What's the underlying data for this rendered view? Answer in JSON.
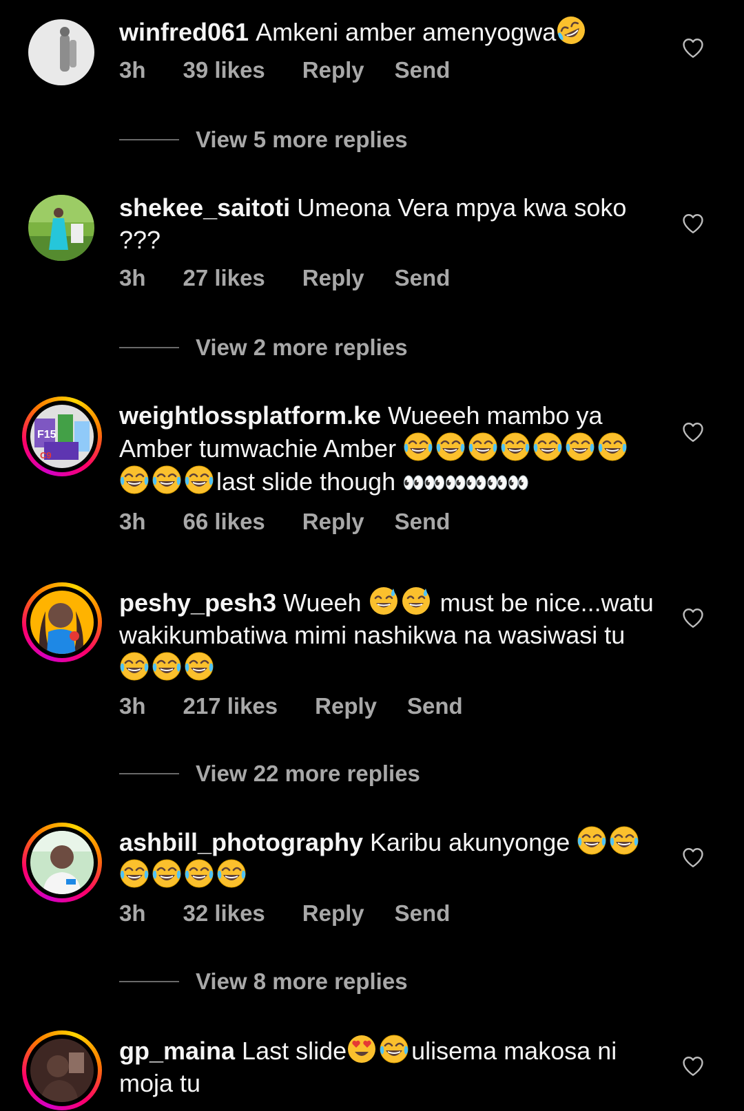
{
  "colors": {
    "background": "#000000",
    "primary_text": "#f5f5f5",
    "secondary_text": "#a8a8a8",
    "divider": "#6a6a6a"
  },
  "comments": [
    {
      "username": "winfred061",
      "text": "Amkeni amber amenyogwa",
      "time": "3h",
      "likes": "39 likes",
      "reply": "Reply",
      "send": "Send",
      "view_replies": "View 5 more replies"
    },
    {
      "username": "shekee_saitoti",
      "text": "Umeona Vera mpya kwa soko ???",
      "time": "3h",
      "likes": "27 likes",
      "reply": "Reply",
      "send": "Send",
      "view_replies": "View 2 more replies"
    },
    {
      "username": "weightlossplatform.ke",
      "text_a": "Wueeeh mambo ya Amber tumwachie Amber",
      "text_b": "last slide though",
      "eyes": "👀👀👀👀👀👀",
      "time": "3h",
      "likes": "66 likes",
      "reply": "Reply",
      "send": "Send"
    },
    {
      "username": "peshy_pesh3",
      "text_a": "Wueeh",
      "text_b": "must be nice...watu wakikumbatiwa mimi nashikwa na wasiwasi tu",
      "time": "3h",
      "likes": "217 likes",
      "reply": "Reply",
      "send": "Send",
      "view_replies": "View 22 more replies"
    },
    {
      "username": "ashbill_photography",
      "text": "Karibu akunyonge",
      "time": "3h",
      "likes": "32 likes",
      "reply": "Reply",
      "send": "Send",
      "view_replies": "View 8 more replies"
    },
    {
      "username": "gp_maina",
      "text_a": "Last slide",
      "text_b": "ulisema makosa ni moja tu"
    }
  ],
  "icons": {
    "like": "heart-outline-icon",
    "laughing": "face-with-tears-of-joy",
    "rofl": "rolling-on-floor-laughing",
    "sweat_smile": "grinning-face-with-sweat",
    "heart_eyes": "smiling-face-with-heart-eyes"
  }
}
